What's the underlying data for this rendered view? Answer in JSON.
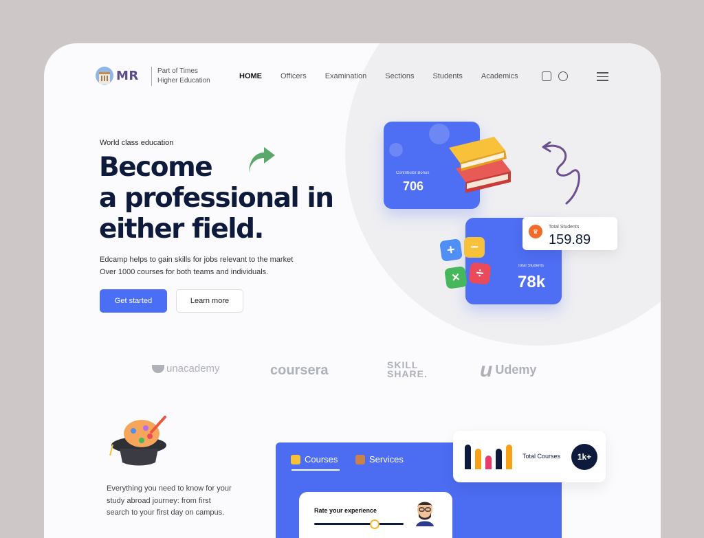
{
  "header": {
    "logo_text": "MR",
    "tagline_line1": "Part of Times",
    "tagline_line2": "Higher Education",
    "nav": [
      "HOME",
      "Officers",
      "Examination",
      "Sections",
      "Students",
      "Academics"
    ],
    "active_nav": "HOME",
    "icons": [
      "profile-icon",
      "globe-icon",
      "hamburger-menu-icon"
    ]
  },
  "hero": {
    "eyebrow": "World class education",
    "headline": [
      "Become",
      "a professional in",
      "either field."
    ],
    "description_line1": "Edcamp helps to gain skills for jobs relevant to the market",
    "description_line2": "Over 1000 courses for both teams and individuals.",
    "primary_button": "Get started",
    "secondary_button": "Learn more"
  },
  "stats": {
    "contributor_label": "Contributor Bonus",
    "contributor_value": "706",
    "total_students_label": "Total Students",
    "total_students_value": "78k",
    "card_label": "Total Students",
    "card_value": "159.89"
  },
  "partners": [
    "unacademy",
    "coursera",
    "SKILL SHARE.",
    "Udemy"
  ],
  "bottom": {
    "description_line1": "Everything you need to know for your",
    "description_line2": "study abroad journey: from first",
    "description_line3": "search to your first day on campus.",
    "tabs": [
      "Courses",
      "Services"
    ],
    "active_tab": "Courses",
    "rate_label": "Rate your experience",
    "rating_fraction": 0.65,
    "total_courses_label": "Total Courses",
    "total_courses_value": "1k+"
  },
  "colors": {
    "brand_blue": "#4a6ef5",
    "navy": "#0e1a3b",
    "background": "#cdc7c7",
    "accent_orange": "#f36b2a",
    "arrow_green": "#5aa86b",
    "arrow_purple": "#6d4f8e"
  }
}
